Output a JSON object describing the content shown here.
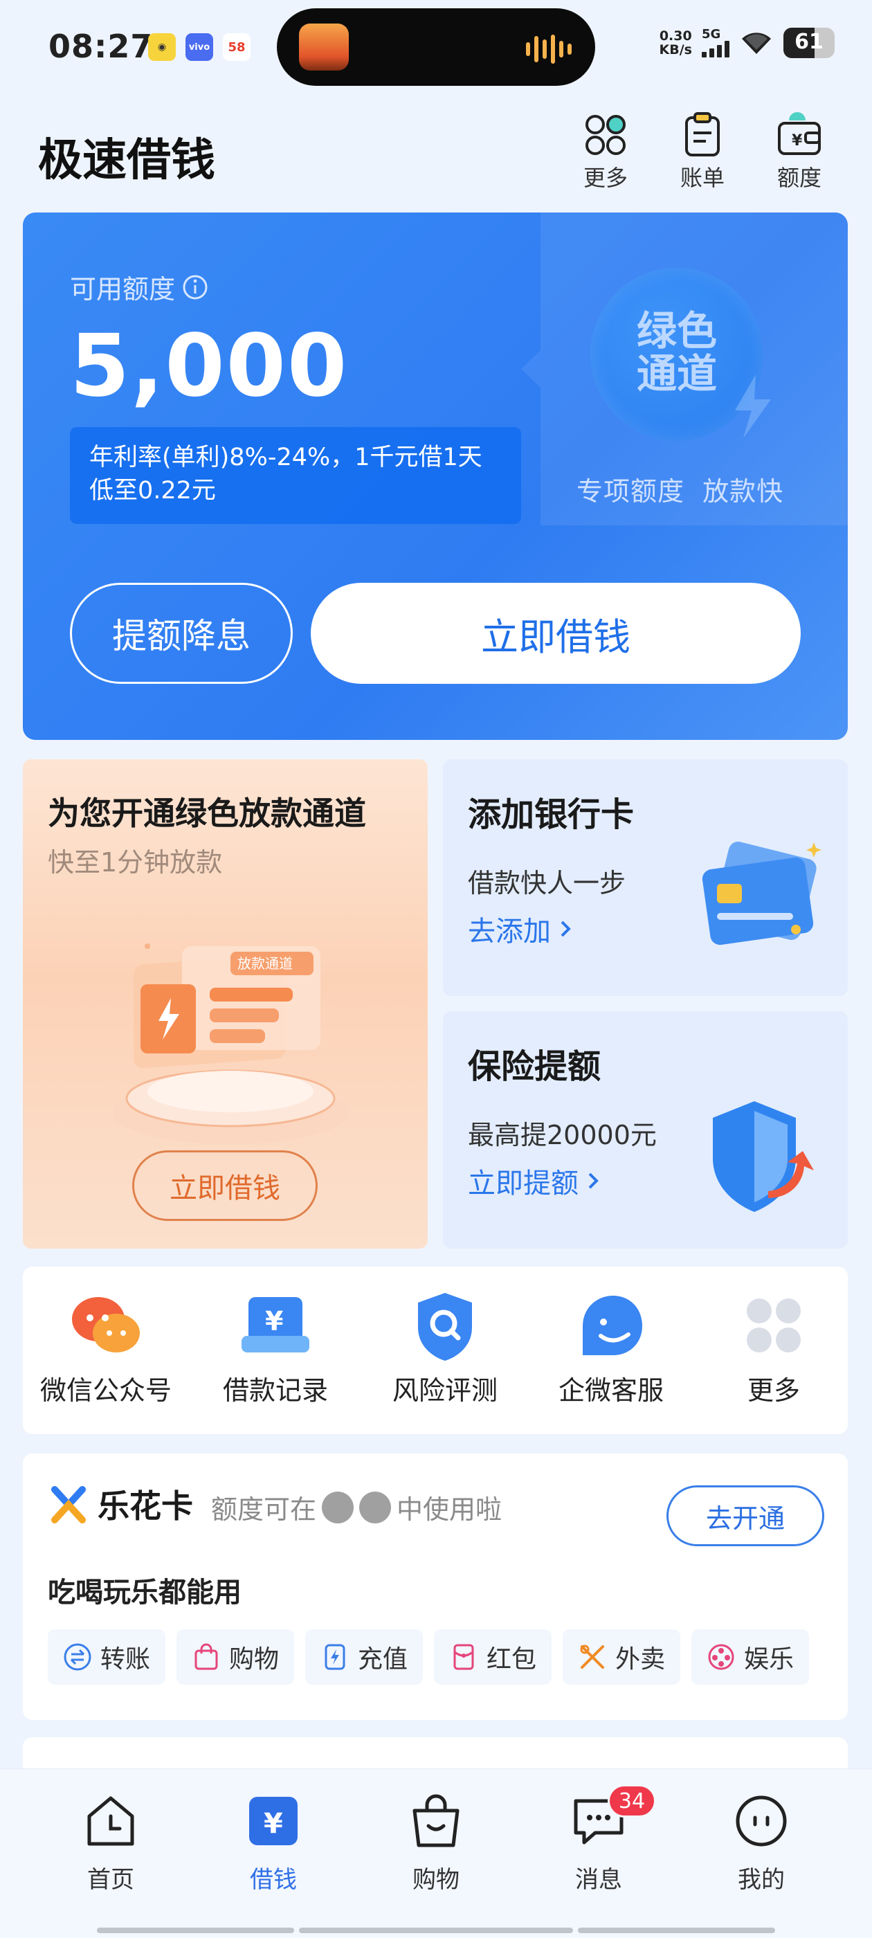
{
  "status_bar": {
    "time": "08:27",
    "apps": [
      "app-icon-yellow",
      "vivo",
      "58"
    ],
    "net_speed": "0.30",
    "net_unit": "KB/s",
    "network": "5G",
    "battery": "61",
    "battery_level": 0.61
  },
  "header": {
    "title": "极速借钱",
    "actions": [
      {
        "label": "更多",
        "icon": "grid-icon"
      },
      {
        "label": "账单",
        "icon": "bill-icon"
      },
      {
        "label": "额度",
        "icon": "wallet-icon"
      }
    ]
  },
  "hero": {
    "quota_label": "可用额度",
    "amount": "5,000",
    "rate_text": "年利率(单利)8%-24%，1千元借1天低至0.22元",
    "badge_text": "绿色通道",
    "badge_sub": "专项额度  放款快",
    "btn_raise": "提额降息",
    "btn_borrow": "立即借钱"
  },
  "promo_green": {
    "title": "为您开通绿色放款通道",
    "subtitle": "快至1分钟放款",
    "illu_tag": "放款通道",
    "button": "立即借钱"
  },
  "promo_bank": {
    "title": "添加银行卡",
    "subtitle": "借款快人一步",
    "link": "去添加"
  },
  "promo_insurance": {
    "title": "保险提额",
    "subtitle": "最高提20000元",
    "link": "立即提额"
  },
  "quick_actions": [
    {
      "label": "微信公众号",
      "icon": "wechat-icon"
    },
    {
      "label": "借款记录",
      "icon": "loan-record-icon"
    },
    {
      "label": "风险评测",
      "icon": "risk-assessment-icon"
    },
    {
      "label": "企微客服",
      "icon": "customer-service-icon"
    },
    {
      "label": "更多",
      "icon": "more-grid-icon"
    }
  ],
  "lehua": {
    "name": "乐花卡",
    "desc_pre": "额度可在",
    "desc_post": "中使用啦",
    "open_button": "去开通",
    "slogan": "吃喝玩乐都能用",
    "chips": [
      {
        "label": "转账",
        "icon": "transfer-icon"
      },
      {
        "label": "购物",
        "icon": "shopping-bag-icon"
      },
      {
        "label": "充值",
        "icon": "recharge-icon"
      },
      {
        "label": "红包",
        "icon": "red-packet-icon"
      },
      {
        "label": "外卖",
        "icon": "takeout-icon"
      },
      {
        "label": "娱乐",
        "icon": "entertainment-icon"
      }
    ]
  },
  "tabbar": {
    "tabs": [
      {
        "label": "首页",
        "icon": "home-clock-icon"
      },
      {
        "label": "借钱",
        "icon": "yuan-icon",
        "active": true
      },
      {
        "label": "购物",
        "icon": "shopping-bag-icon"
      },
      {
        "label": "消息",
        "icon": "message-icon",
        "badge": "34"
      },
      {
        "label": "我的",
        "icon": "profile-icon"
      }
    ]
  },
  "colors": {
    "brand_blue": "#2f7cf2",
    "accent_orange": "#e06a2c",
    "badge_red": "#f0384b"
  }
}
